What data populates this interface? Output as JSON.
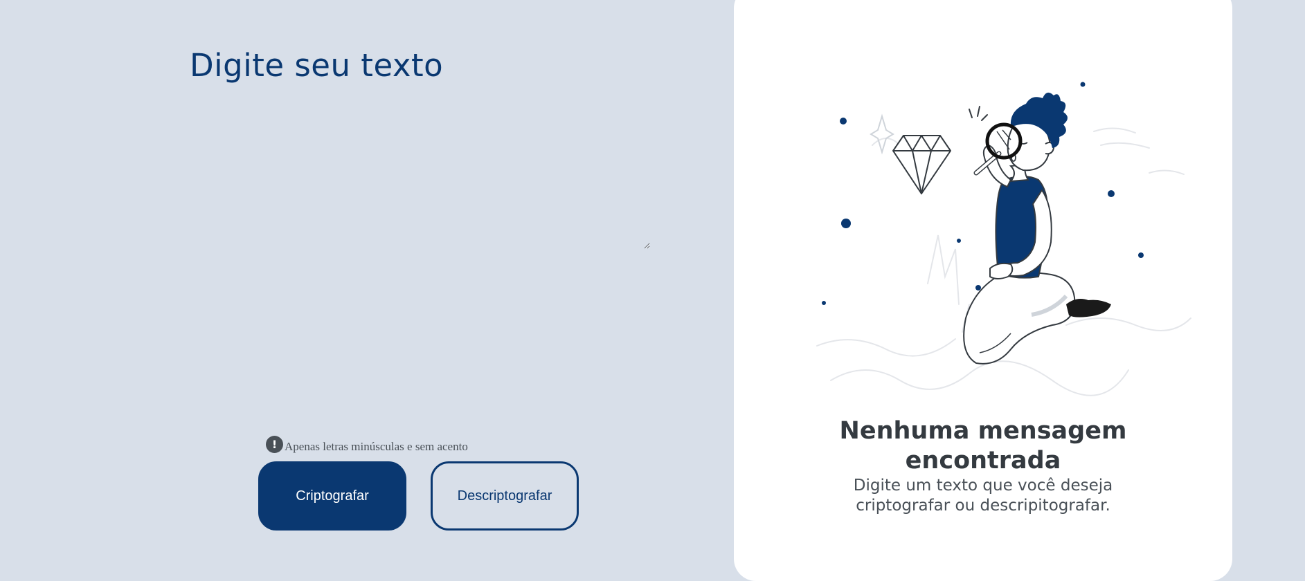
{
  "input": {
    "title": "Digite seu texto",
    "value": ""
  },
  "hint": {
    "icon": "exclamation-circle-icon",
    "text": "Apenas letras minúsculas e sem acento"
  },
  "buttons": {
    "encrypt_label": "Criptografar",
    "decrypt_label": "Descriptografar"
  },
  "output": {
    "empty_title": "Nenhuma mensagem encontrada",
    "empty_description": "Digite um texto que você deseja criptografar ou descripitografar."
  },
  "colors": {
    "background": "#d8dfe9",
    "accent": "#0a3871",
    "panel": "#ffffff",
    "text_dark": "#343a40",
    "text_gray": "#495057"
  }
}
